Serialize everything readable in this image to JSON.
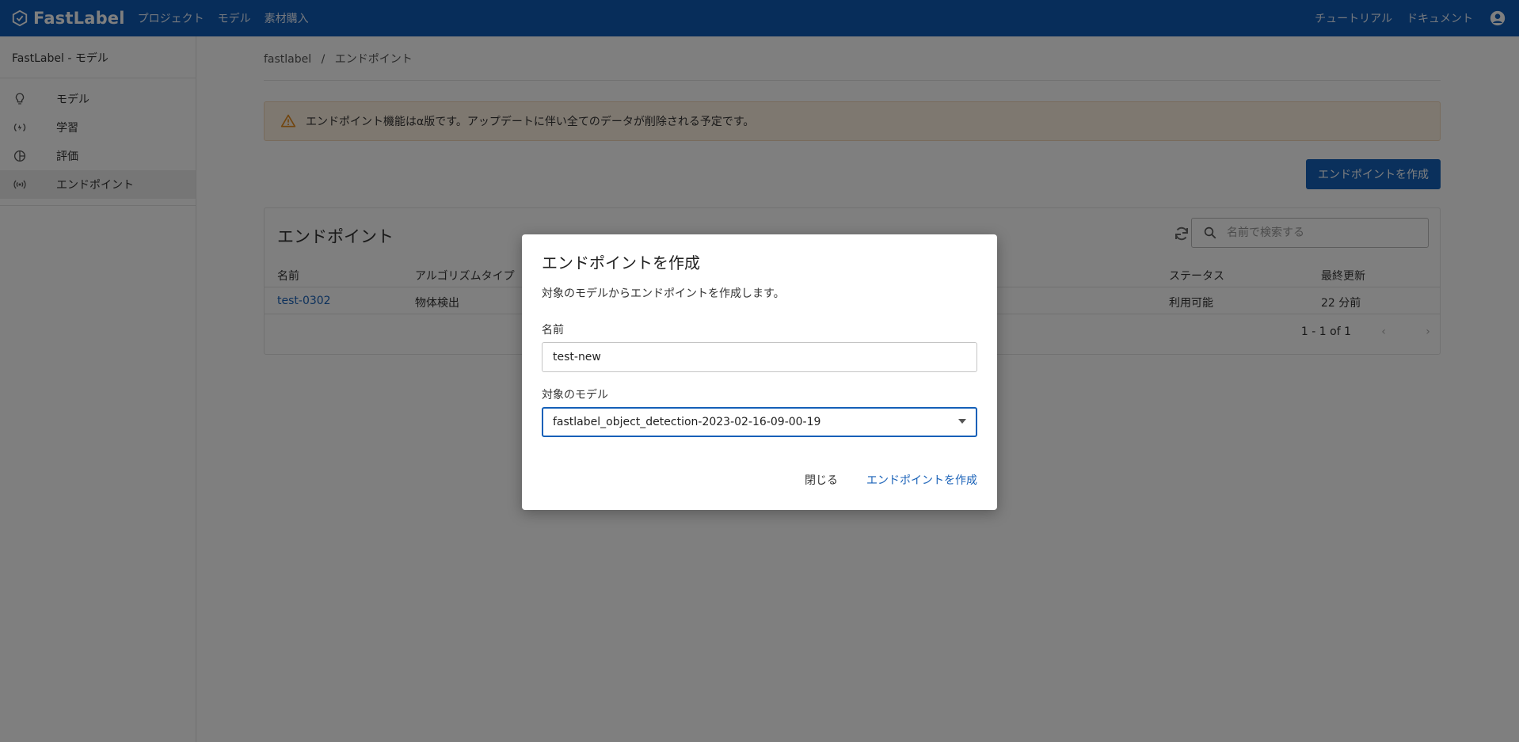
{
  "header": {
    "brand": "FastLabel",
    "nav": [
      "プロジェクト",
      "モデル",
      "素材購入"
    ],
    "links": [
      "チュートリアル",
      "ドキュメント"
    ]
  },
  "sidebar": {
    "title": "FastLabel - モデル",
    "items": [
      {
        "label": "モデル",
        "icon": "lightbulb-icon"
      },
      {
        "label": "学習",
        "icon": "training-icon"
      },
      {
        "label": "評価",
        "icon": "evaluation-icon"
      },
      {
        "label": "エンドポイント",
        "icon": "broadcast-icon"
      }
    ]
  },
  "breadcrumb": {
    "root": "fastlabel",
    "separator": "/",
    "current": "エンドポイント"
  },
  "alert": {
    "text": "エンドポイント機能はα版です。アップデートに伴い全てのデータが削除される予定です。"
  },
  "toolbar": {
    "create_label": "エンドポイントを作成"
  },
  "card": {
    "title": "エンドポイント",
    "search_placeholder": "名前で検索する",
    "columns": [
      "名前",
      "アルゴリズムタイプ",
      "ステータス",
      "最終更新"
    ],
    "rows": [
      {
        "name": "test-0302",
        "algorithm": "物体検出",
        "status": "利用可能",
        "updated": "22 分前"
      }
    ],
    "pagination": "1 - 1 of 1"
  },
  "modal": {
    "title": "エンドポイントを作成",
    "description": "対象のモデルからエンドポイントを作成します。",
    "name_label": "名前",
    "name_value": "test-new",
    "model_label": "対象のモデル",
    "model_value": "fastlabel_object_detection-2023-02-16-09-00-19",
    "close_label": "閉じる",
    "submit_label": "エンドポイントを作成"
  },
  "colors": {
    "primary": "#0e5ab4",
    "button": "#1460b8",
    "link": "#1a62b8",
    "alert_bg": "#fdf0e1",
    "warning": "#e38a1c"
  }
}
